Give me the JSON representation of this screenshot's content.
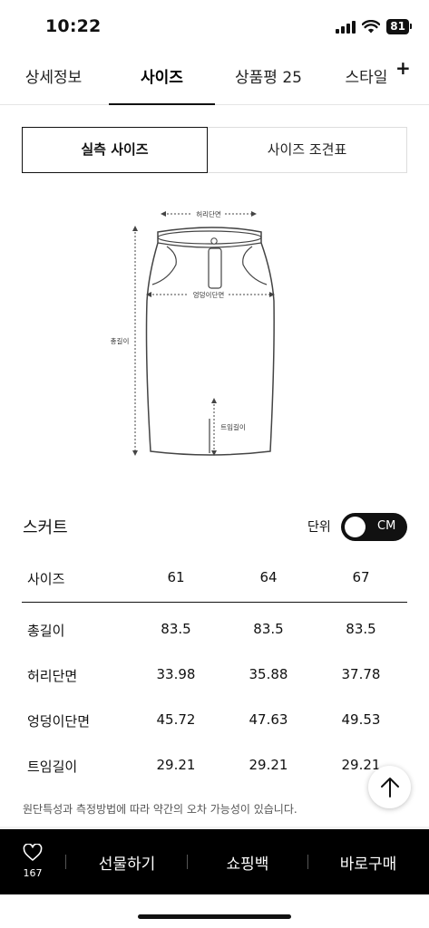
{
  "status_bar": {
    "time": "10:22",
    "battery": "81"
  },
  "tabs": [
    {
      "label": "상세정보"
    },
    {
      "label": "사이즈"
    },
    {
      "label": "상품평 25"
    },
    {
      "label": "스타일"
    }
  ],
  "size_toggle": {
    "measured": "실측 사이즈",
    "chart": "사이즈 조견표"
  },
  "diagram": {
    "waist": "허리단면",
    "hip": "엉덩이단면",
    "total_length": "총길이",
    "slit_length": "트임길이"
  },
  "section_title": "스커트",
  "unit": {
    "label": "단위",
    "value": "CM"
  },
  "table": {
    "headers": [
      "사이즈",
      "61",
      "64",
      "67"
    ],
    "rows": [
      [
        "총길이",
        "83.5",
        "83.5",
        "83.5"
      ],
      [
        "허리단면",
        "33.98",
        "35.88",
        "37.78"
      ],
      [
        "엉덩이단면",
        "45.72",
        "47.63",
        "49.53"
      ],
      [
        "트임길이",
        "29.21",
        "29.21",
        "29.21"
      ]
    ]
  },
  "note": "원단특성과 측정방법에 따라 약간의 오차 가능성이 있습니다.",
  "bottom_bar": {
    "like_count": "167",
    "gift": "선물하기",
    "cart": "쇼핑백",
    "buy": "바로구매"
  }
}
